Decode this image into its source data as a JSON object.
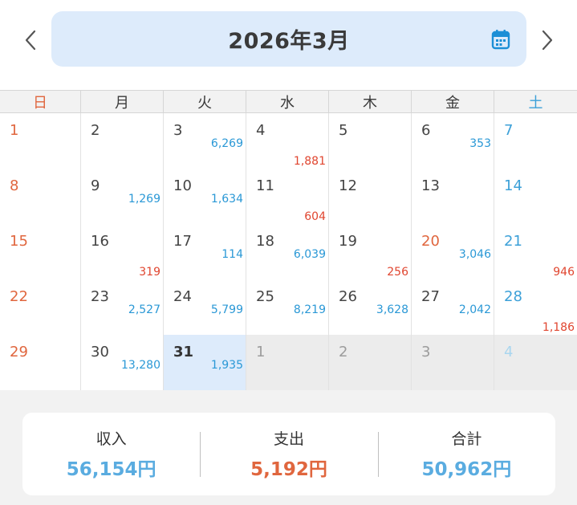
{
  "header": {
    "month_title": "2026年3月",
    "prev_icon": "chevron-left-icon",
    "next_icon": "chevron-right-icon",
    "calendar_icon": "calendar-icon",
    "pill_color": "#ddebfb"
  },
  "weekdays": [
    "日",
    "月",
    "火",
    "水",
    "木",
    "金",
    "土"
  ],
  "colors": {
    "sunday": "#e0663e",
    "saturday": "#3ca0d8",
    "income": "#2a98d6",
    "expense": "#e0452f",
    "today_bg": "#ddebfb"
  },
  "weeks": [
    [
      {
        "day": "1",
        "type": "sun"
      },
      {
        "day": "2"
      },
      {
        "day": "3",
        "income": "6,269"
      },
      {
        "day": "4",
        "expense": "1,881"
      },
      {
        "day": "5"
      },
      {
        "day": "6",
        "income": "353"
      },
      {
        "day": "7",
        "type": "sat"
      }
    ],
    [
      {
        "day": "8",
        "type": "sun"
      },
      {
        "day": "9",
        "income": "1,269"
      },
      {
        "day": "10",
        "income": "1,634"
      },
      {
        "day": "11",
        "expense": "604"
      },
      {
        "day": "12"
      },
      {
        "day": "13"
      },
      {
        "day": "14",
        "type": "sat"
      }
    ],
    [
      {
        "day": "15",
        "type": "sun"
      },
      {
        "day": "16",
        "expense": "319"
      },
      {
        "day": "17",
        "income": "114"
      },
      {
        "day": "18",
        "income": "6,039"
      },
      {
        "day": "19",
        "expense": "256"
      },
      {
        "day": "20",
        "type": "holiday",
        "income": "3,046"
      },
      {
        "day": "21",
        "type": "sat",
        "expense": "946"
      }
    ],
    [
      {
        "day": "22",
        "type": "sun"
      },
      {
        "day": "23",
        "income": "2,527"
      },
      {
        "day": "24",
        "income": "5,799"
      },
      {
        "day": "25",
        "income": "8,219"
      },
      {
        "day": "26",
        "income": "3,628"
      },
      {
        "day": "27",
        "income": "2,042"
      },
      {
        "day": "28",
        "type": "sat",
        "expense": "1,186"
      }
    ],
    [
      {
        "day": "29",
        "type": "sun"
      },
      {
        "day": "30",
        "income": "13,280"
      },
      {
        "day": "31",
        "today": true,
        "income": "1,935"
      },
      {
        "day": "1",
        "other": true
      },
      {
        "day": "2",
        "other": true
      },
      {
        "day": "3",
        "other": true
      },
      {
        "day": "4",
        "other": true,
        "type": "sat"
      }
    ]
  ],
  "summary": {
    "income_label": "収入",
    "income_value": "56,154円",
    "expense_label": "支出",
    "expense_value": "5,192円",
    "total_label": "合計",
    "total_value": "50,962円"
  }
}
